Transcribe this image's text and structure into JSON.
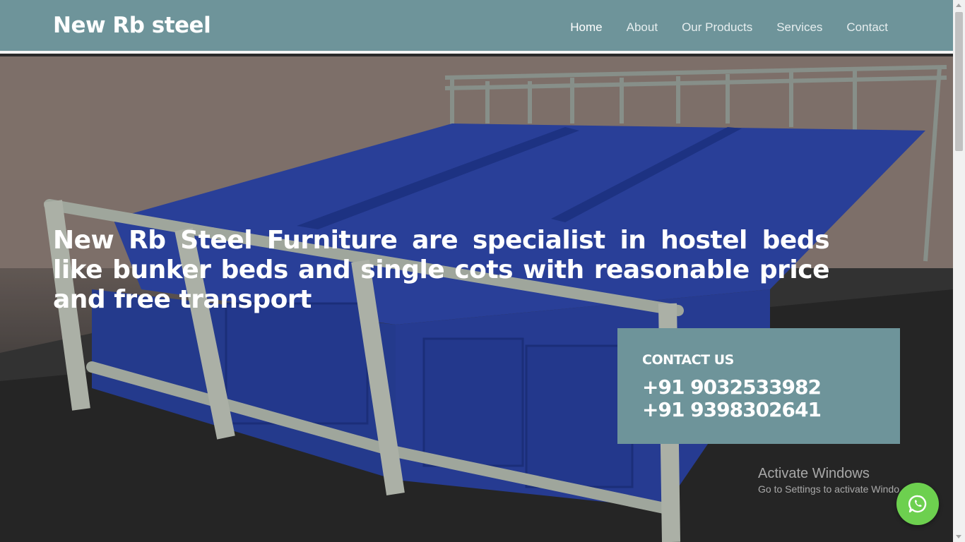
{
  "nav": {
    "brand": "New Rb steel",
    "links": [
      "Home",
      "About",
      "Our Products",
      "Services",
      "Contact"
    ],
    "active": "Home"
  },
  "hero": {
    "headline": "New Rb Steel Furniture are specialist in hostel beds like bunker beds and single cots with reasonable price and free transport",
    "image_subject": "blue-steel-hostel-beds"
  },
  "contact": {
    "title": "CONTACT US",
    "phones": [
      "+91 9032533982",
      "+91 9398302641"
    ]
  },
  "watermark": {
    "title": "Activate Windows",
    "subtitle": "Go to Settings to activate Windows."
  },
  "whatsapp": {
    "icon": "whatsapp-icon"
  },
  "colors": {
    "nav_bg": "#6e949a",
    "contact_bg": "#6e949a",
    "whatsapp_bg": "#6dd04f",
    "bed_blue": "#2f48ad"
  }
}
